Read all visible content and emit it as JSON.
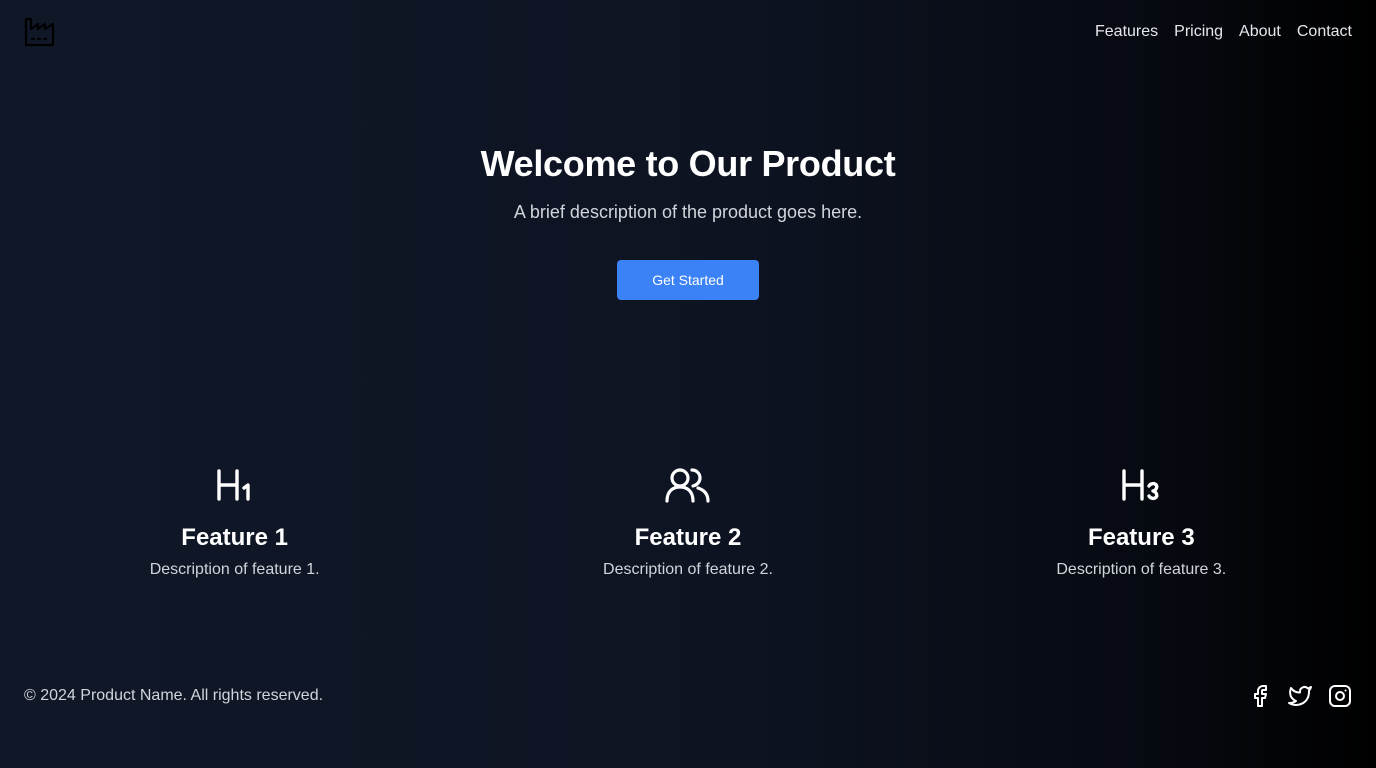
{
  "header": {
    "logo_icon": "factory-icon",
    "nav": [
      {
        "label": "Features"
      },
      {
        "label": "Pricing"
      },
      {
        "label": "About"
      },
      {
        "label": "Contact"
      }
    ]
  },
  "hero": {
    "title": "Welcome to Our Product",
    "subtitle": "A brief description of the product goes here.",
    "cta_label": "Get Started"
  },
  "features": [
    {
      "icon": "heading-1-icon",
      "title": "Feature 1",
      "description": "Description of feature 1."
    },
    {
      "icon": "users-icon",
      "title": "Feature 2",
      "description": "Description of feature 2."
    },
    {
      "icon": "heading-3-icon",
      "title": "Feature 3",
      "description": "Description of feature 3."
    }
  ],
  "footer": {
    "copyright": "© 2024 Product Name. All rights reserved.",
    "socials": [
      {
        "icon": "facebook-icon"
      },
      {
        "icon": "twitter-icon"
      },
      {
        "icon": "instagram-icon"
      }
    ]
  },
  "colors": {
    "accent": "#3b82f6",
    "background_start": "#101828",
    "background_end": "#000000",
    "text_muted": "#d1d5db"
  }
}
